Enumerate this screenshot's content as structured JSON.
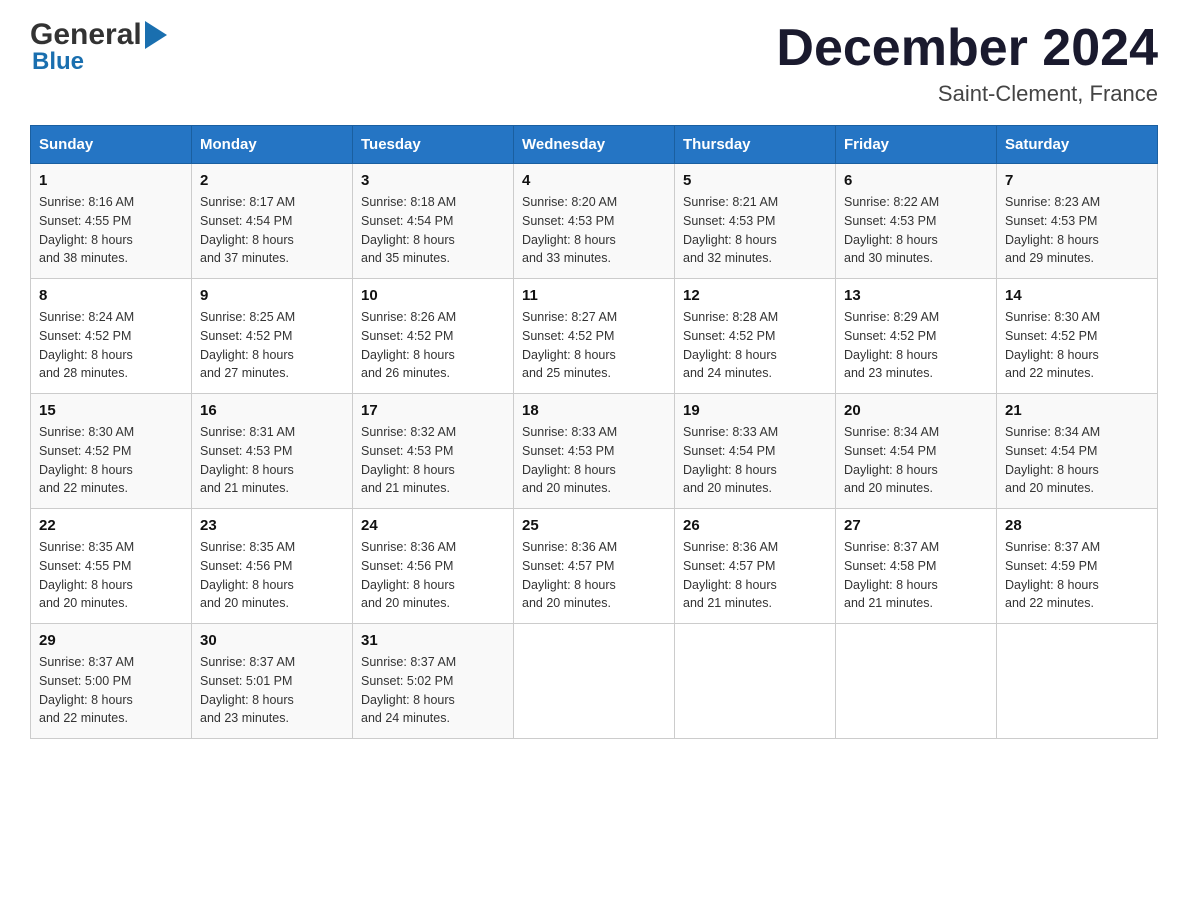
{
  "logo": {
    "general": "General",
    "blue": "Blue",
    "triangle_char": "▶"
  },
  "title": {
    "month_year": "December 2024",
    "location": "Saint-Clement, France"
  },
  "headers": [
    "Sunday",
    "Monday",
    "Tuesday",
    "Wednesday",
    "Thursday",
    "Friday",
    "Saturday"
  ],
  "weeks": [
    [
      {
        "day": "1",
        "sunrise": "8:16 AM",
        "sunset": "4:55 PM",
        "daylight": "8 hours and 38 minutes."
      },
      {
        "day": "2",
        "sunrise": "8:17 AM",
        "sunset": "4:54 PM",
        "daylight": "8 hours and 37 minutes."
      },
      {
        "day": "3",
        "sunrise": "8:18 AM",
        "sunset": "4:54 PM",
        "daylight": "8 hours and 35 minutes."
      },
      {
        "day": "4",
        "sunrise": "8:20 AM",
        "sunset": "4:53 PM",
        "daylight": "8 hours and 33 minutes."
      },
      {
        "day": "5",
        "sunrise": "8:21 AM",
        "sunset": "4:53 PM",
        "daylight": "8 hours and 32 minutes."
      },
      {
        "day": "6",
        "sunrise": "8:22 AM",
        "sunset": "4:53 PM",
        "daylight": "8 hours and 30 minutes."
      },
      {
        "day": "7",
        "sunrise": "8:23 AM",
        "sunset": "4:53 PM",
        "daylight": "8 hours and 29 minutes."
      }
    ],
    [
      {
        "day": "8",
        "sunrise": "8:24 AM",
        "sunset": "4:52 PM",
        "daylight": "8 hours and 28 minutes."
      },
      {
        "day": "9",
        "sunrise": "8:25 AM",
        "sunset": "4:52 PM",
        "daylight": "8 hours and 27 minutes."
      },
      {
        "day": "10",
        "sunrise": "8:26 AM",
        "sunset": "4:52 PM",
        "daylight": "8 hours and 26 minutes."
      },
      {
        "day": "11",
        "sunrise": "8:27 AM",
        "sunset": "4:52 PM",
        "daylight": "8 hours and 25 minutes."
      },
      {
        "day": "12",
        "sunrise": "8:28 AM",
        "sunset": "4:52 PM",
        "daylight": "8 hours and 24 minutes."
      },
      {
        "day": "13",
        "sunrise": "8:29 AM",
        "sunset": "4:52 PM",
        "daylight": "8 hours and 23 minutes."
      },
      {
        "day": "14",
        "sunrise": "8:30 AM",
        "sunset": "4:52 PM",
        "daylight": "8 hours and 22 minutes."
      }
    ],
    [
      {
        "day": "15",
        "sunrise": "8:30 AM",
        "sunset": "4:52 PM",
        "daylight": "8 hours and 22 minutes."
      },
      {
        "day": "16",
        "sunrise": "8:31 AM",
        "sunset": "4:53 PM",
        "daylight": "8 hours and 21 minutes."
      },
      {
        "day": "17",
        "sunrise": "8:32 AM",
        "sunset": "4:53 PM",
        "daylight": "8 hours and 21 minutes."
      },
      {
        "day": "18",
        "sunrise": "8:33 AM",
        "sunset": "4:53 PM",
        "daylight": "8 hours and 20 minutes."
      },
      {
        "day": "19",
        "sunrise": "8:33 AM",
        "sunset": "4:54 PM",
        "daylight": "8 hours and 20 minutes."
      },
      {
        "day": "20",
        "sunrise": "8:34 AM",
        "sunset": "4:54 PM",
        "daylight": "8 hours and 20 minutes."
      },
      {
        "day": "21",
        "sunrise": "8:34 AM",
        "sunset": "4:54 PM",
        "daylight": "8 hours and 20 minutes."
      }
    ],
    [
      {
        "day": "22",
        "sunrise": "8:35 AM",
        "sunset": "4:55 PM",
        "daylight": "8 hours and 20 minutes."
      },
      {
        "day": "23",
        "sunrise": "8:35 AM",
        "sunset": "4:56 PM",
        "daylight": "8 hours and 20 minutes."
      },
      {
        "day": "24",
        "sunrise": "8:36 AM",
        "sunset": "4:56 PM",
        "daylight": "8 hours and 20 minutes."
      },
      {
        "day": "25",
        "sunrise": "8:36 AM",
        "sunset": "4:57 PM",
        "daylight": "8 hours and 20 minutes."
      },
      {
        "day": "26",
        "sunrise": "8:36 AM",
        "sunset": "4:57 PM",
        "daylight": "8 hours and 21 minutes."
      },
      {
        "day": "27",
        "sunrise": "8:37 AM",
        "sunset": "4:58 PM",
        "daylight": "8 hours and 21 minutes."
      },
      {
        "day": "28",
        "sunrise": "8:37 AM",
        "sunset": "4:59 PM",
        "daylight": "8 hours and 22 minutes."
      }
    ],
    [
      {
        "day": "29",
        "sunrise": "8:37 AM",
        "sunset": "5:00 PM",
        "daylight": "8 hours and 22 minutes."
      },
      {
        "day": "30",
        "sunrise": "8:37 AM",
        "sunset": "5:01 PM",
        "daylight": "8 hours and 23 minutes."
      },
      {
        "day": "31",
        "sunrise": "8:37 AM",
        "sunset": "5:02 PM",
        "daylight": "8 hours and 24 minutes."
      },
      null,
      null,
      null,
      null
    ]
  ],
  "labels": {
    "sunrise": "Sunrise:",
    "sunset": "Sunset:",
    "daylight": "Daylight:"
  }
}
